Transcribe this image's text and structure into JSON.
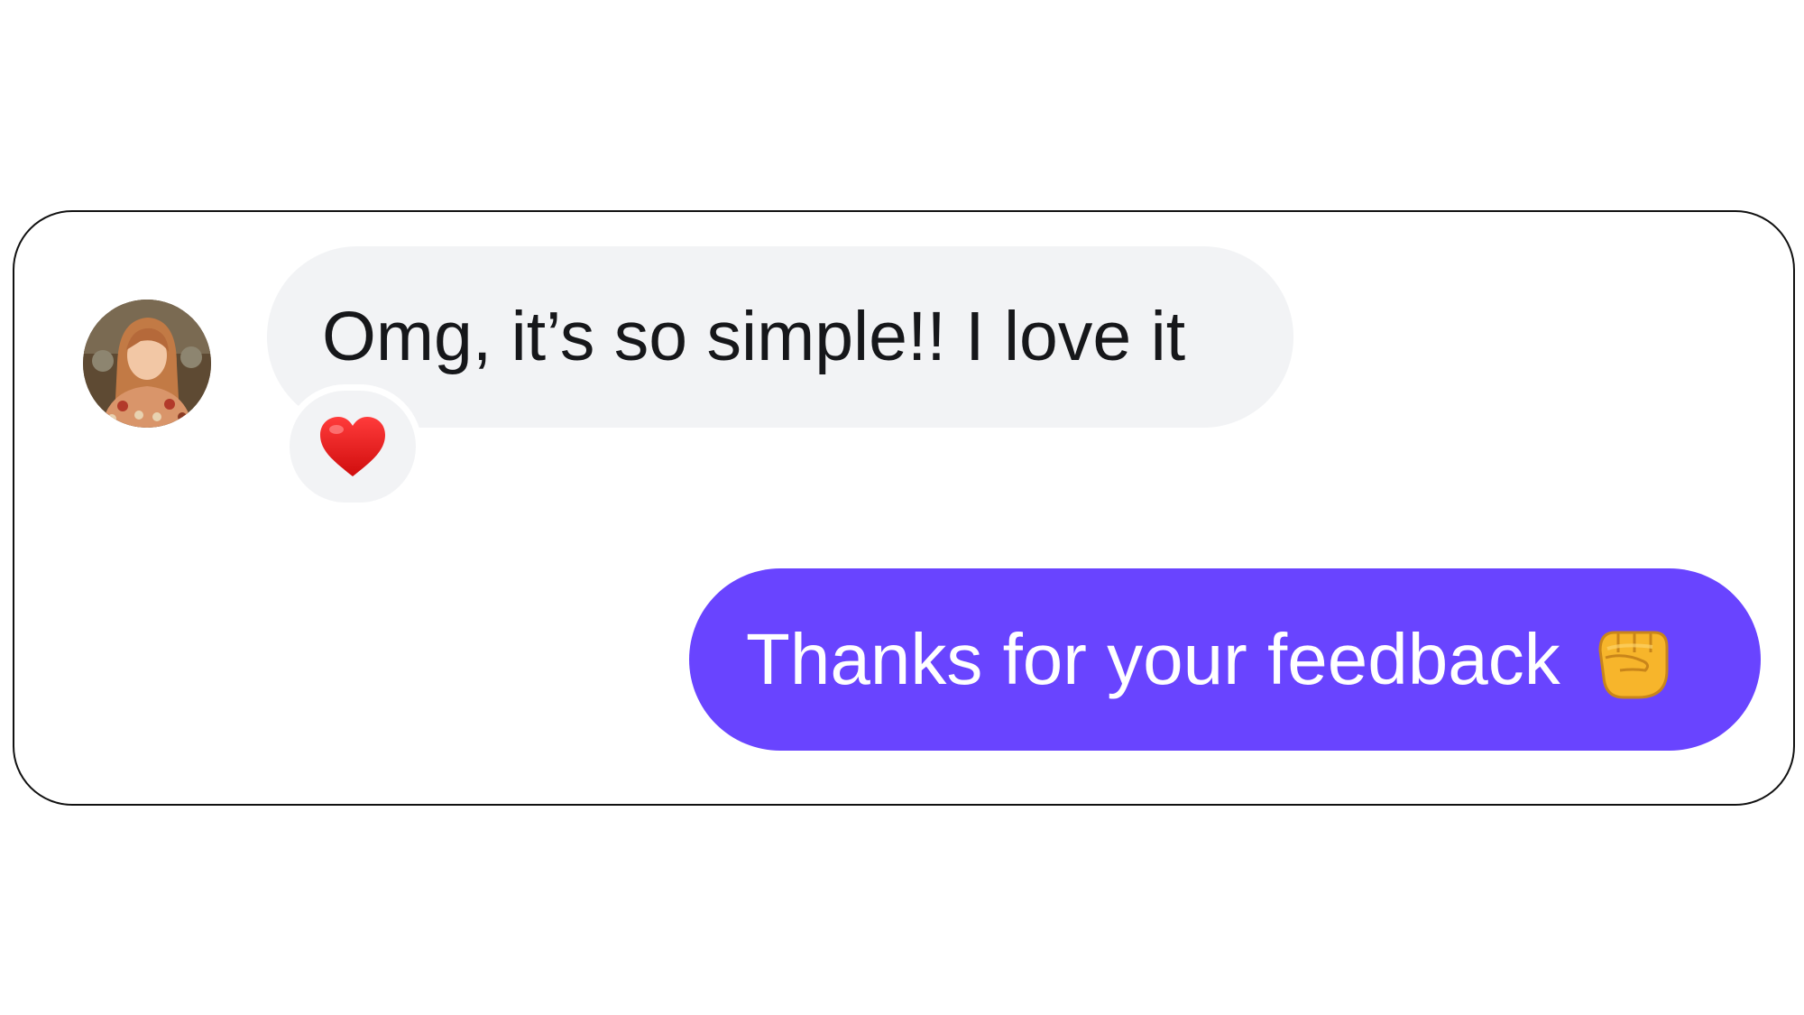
{
  "conversation": {
    "incoming": {
      "text": "Omg, it’s so simple!! I love it",
      "avatar_icon": "user-avatar-photo",
      "reaction_icon": "red-heart-emoji",
      "bubble_color": "#f2f3f5"
    },
    "outgoing": {
      "text": "Thanks for your feedback",
      "emoji_icon": "raised-fist-emoji",
      "bubble_color": "#6944ff"
    }
  }
}
